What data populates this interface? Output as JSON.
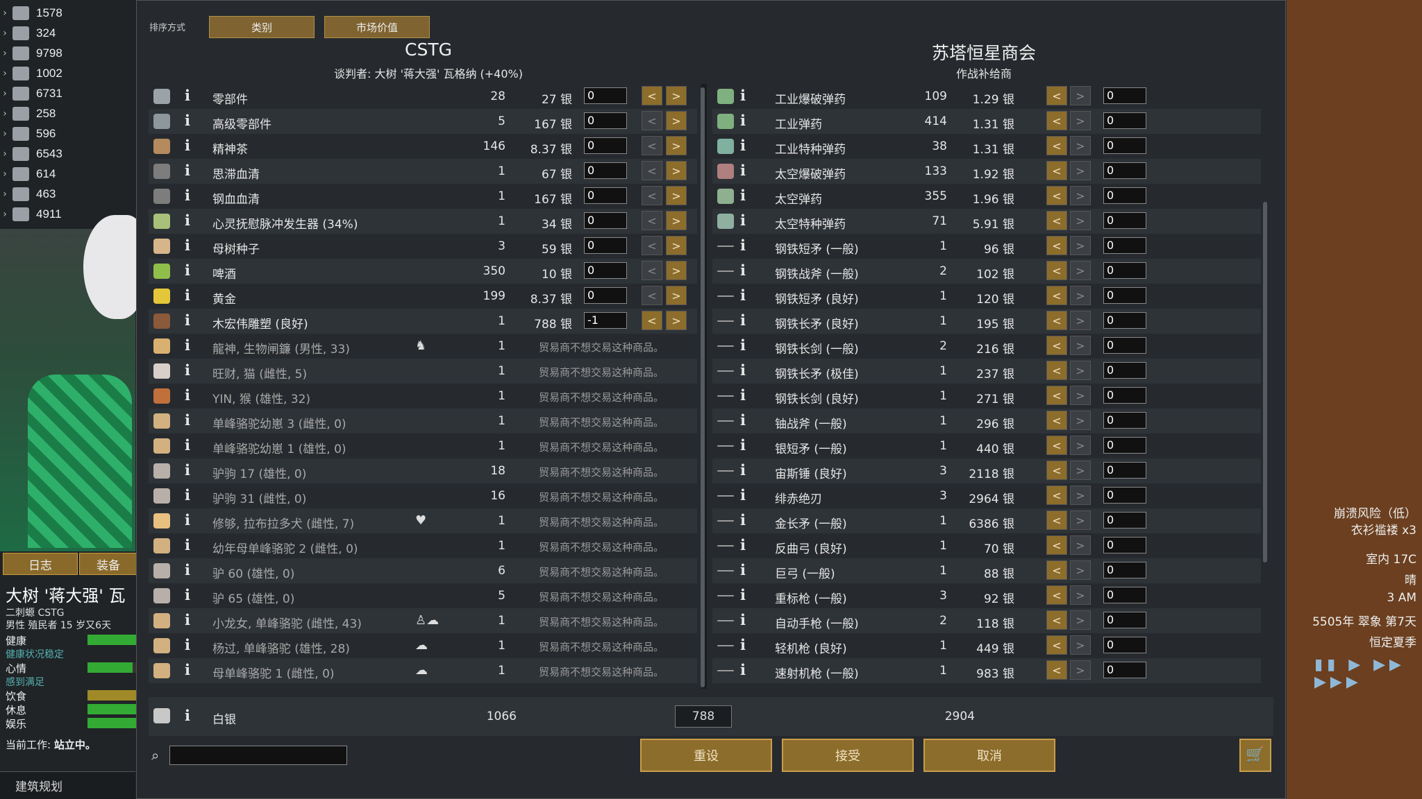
{
  "left_hud": {
    "resources": [
      {
        "icon": "meal-icon",
        "value": "1578"
      },
      {
        "icon": "medicine-icon",
        "value": "324"
      },
      {
        "icon": "textile-icon",
        "value": "9798"
      },
      {
        "icon": "tool-icon",
        "value": "1002"
      },
      {
        "icon": "building-material-icon",
        "value": "6731"
      },
      {
        "icon": "medical-icon",
        "value": "258"
      },
      {
        "icon": "raw-food-icon",
        "value": "596"
      },
      {
        "icon": "stone-icon",
        "value": "6543"
      },
      {
        "icon": "plant-icon",
        "value": "614"
      },
      {
        "icon": "furniture-icon",
        "value": "463"
      },
      {
        "icon": "resource-icon",
        "value": "4911"
      }
    ],
    "tabs": {
      "log": "日志",
      "equip": "装备"
    },
    "colonist": {
      "name": "大树 '蒋大强' 瓦",
      "faction": "二刺螈 CSTG",
      "desc": "男性 殖民者 15 岁又6天",
      "needs": [
        {
          "label": "健康",
          "fill": 1.0,
          "color": "#33aa33"
        },
        {
          "label": "健康状况稳定",
          "fill": null,
          "color": "#55b0b0"
        },
        {
          "label": "心情",
          "fill": 0.9,
          "color": "#33aa33"
        },
        {
          "label": "感到满足",
          "fill": null,
          "color": "#55b0b0"
        },
        {
          "label": "饮食",
          "fill": 1.0,
          "color": "#a08a28"
        },
        {
          "label": "休息",
          "fill": 1.0,
          "color": "#33aa33"
        },
        {
          "label": "娱乐",
          "fill": 1.0,
          "color": "#33aa33"
        }
      ],
      "job_label": "当前工作:",
      "job_value": "站立中。"
    },
    "architect": "建筑规划"
  },
  "right_hud": {
    "alert1": "崩溃风险（低）",
    "alert2": "衣衫褴褛 x3",
    "temp": "室内 17C",
    "weather": "晴",
    "time": "3 AM",
    "date": "5505年 翠象 第7天",
    "season": "恒定夏季"
  },
  "dialog": {
    "sort_label": "排序方式",
    "sort_btn1": "类别",
    "sort_btn2": "市场价值",
    "left_title": "CSTG",
    "left_sub": "谈判者: 大树 '蒋大强' 瓦格纳 (+40%)",
    "right_title": "苏塔恒星商会",
    "right_sub": "作战补给商",
    "silver": {
      "name": "白银",
      "left": "1066",
      "trade": "788",
      "right": "2904"
    },
    "buttons": {
      "reset": "重设",
      "accept": "接受",
      "cancel": "取消"
    },
    "left_items": [
      {
        "name": "零部件",
        "count": "28",
        "price": "27 银",
        "qty": "0",
        "left_on": true
      },
      {
        "name": "高级零部件",
        "count": "5",
        "price": "167 银",
        "qty": "0",
        "left_on": false
      },
      {
        "name": "精神茶",
        "count": "146",
        "price": "8.37 银",
        "qty": "0",
        "left_on": false
      },
      {
        "name": "思滞血清",
        "count": "1",
        "price": "67 银",
        "qty": "0",
        "left_on": false
      },
      {
        "name": "钢血血清",
        "count": "1",
        "price": "167 银",
        "qty": "0",
        "left_on": false
      },
      {
        "name": "心灵抚慰脉冲发生器 (34%)",
        "count": "1",
        "price": "34 银",
        "qty": "0",
        "left_on": false
      },
      {
        "name": "母树种子",
        "count": "3",
        "price": "59 银",
        "qty": "0",
        "left_on": false
      },
      {
        "name": "啤酒",
        "count": "350",
        "price": "10 银",
        "qty": "0",
        "left_on": false
      },
      {
        "name": "黄金",
        "count": "199",
        "price": "8.37 银",
        "qty": "0",
        "left_on": false
      },
      {
        "name": "木宏伟雕塑 (良好)",
        "count": "1",
        "price": "788 银",
        "qty": "-1",
        "left_on": true
      },
      {
        "name": "龍神, 生物闸鐮 (男性, 33)",
        "count": "1",
        "mark": "♞",
        "note": "贸易商不想交易这种商品。"
      },
      {
        "name": "旺财, 猫 (雌性, 5)",
        "count": "1",
        "note": "贸易商不想交易这种商品。"
      },
      {
        "name": "YIN, 猴 (雄性, 32)",
        "count": "1",
        "note": "贸易商不想交易这种商品。"
      },
      {
        "name": "单峰骆驼幼崽 3 (雌性, 0)",
        "count": "1",
        "note": "贸易商不想交易这种商品。"
      },
      {
        "name": "单峰骆驼幼崽 1 (雄性, 0)",
        "count": "1",
        "note": "贸易商不想交易这种商品。"
      },
      {
        "name": "驴驹 17 (雄性, 0)",
        "count": "18",
        "note": "贸易商不想交易这种商品。"
      },
      {
        "name": "驴驹 31 (雌性, 0)",
        "count": "16",
        "note": "贸易商不想交易这种商品。"
      },
      {
        "name": "修够, 拉布拉多犬 (雌性, 7)",
        "count": "1",
        "mark": "♥",
        "note": "贸易商不想交易这种商品。"
      },
      {
        "name": "幼年母单峰骆驼 2 (雌性, 0)",
        "count": "1",
        "note": "贸易商不想交易这种商品。"
      },
      {
        "name": "驴 60 (雄性, 0)",
        "count": "6",
        "note": "贸易商不想交易这种商品。"
      },
      {
        "name": "驴 65 (雄性, 0)",
        "count": "5",
        "note": "贸易商不想交易这种商品。"
      },
      {
        "name": "小龙女, 单峰骆驼 (雌性, 43)",
        "count": "1",
        "mark": "♙☁",
        "note": "贸易商不想交易这种商品。"
      },
      {
        "name": "杨过, 单峰骆驼 (雄性, 28)",
        "count": "1",
        "mark": "☁",
        "note": "贸易商不想交易这种商品。"
      },
      {
        "name": "母单峰骆驼 1 (雌性, 0)",
        "count": "1",
        "mark": "☁",
        "note": "贸易商不想交易这种商品。"
      }
    ],
    "right_items": [
      {
        "name": "工业爆破弹药",
        "count": "109",
        "price": "1.29 银",
        "qty": "0"
      },
      {
        "name": "工业弹药",
        "count": "414",
        "price": "1.31 银",
        "qty": "0"
      },
      {
        "name": "工业特种弹药",
        "count": "38",
        "price": "1.31 银",
        "qty": "0"
      },
      {
        "name": "太空爆破弹药",
        "count": "133",
        "price": "1.92 银",
        "qty": "0"
      },
      {
        "name": "太空弹药",
        "count": "355",
        "price": "1.96 银",
        "qty": "0"
      },
      {
        "name": "太空特种弹药",
        "count": "71",
        "price": "5.91 银",
        "qty": "0"
      },
      {
        "name": "钢铁短矛 (一般)",
        "count": "1",
        "price": "96 银",
        "qty": "0"
      },
      {
        "name": "钢铁战斧 (一般)",
        "count": "2",
        "price": "102 银",
        "qty": "0"
      },
      {
        "name": "钢铁短矛 (良好)",
        "count": "1",
        "price": "120 银",
        "qty": "0"
      },
      {
        "name": "钢铁长矛 (良好)",
        "count": "1",
        "price": "195 银",
        "qty": "0"
      },
      {
        "name": "钢铁长剑 (一般)",
        "count": "2",
        "price": "216 银",
        "qty": "0"
      },
      {
        "name": "钢铁长矛 (极佳)",
        "count": "1",
        "price": "237 银",
        "qty": "0"
      },
      {
        "name": "钢铁长剑 (良好)",
        "count": "1",
        "price": "271 银",
        "qty": "0"
      },
      {
        "name": "铀战斧 (一般)",
        "count": "1",
        "price": "296 银",
        "qty": "0"
      },
      {
        "name": "银短矛 (一般)",
        "count": "1",
        "price": "440 银",
        "qty": "0"
      },
      {
        "name": "宙斯锤 (良好)",
        "count": "3",
        "price": "2118 银",
        "qty": "0"
      },
      {
        "name": "绯赤绝刃",
        "count": "3",
        "price": "2964 银",
        "qty": "0"
      },
      {
        "name": "金长矛 (一般)",
        "count": "1",
        "price": "6386 银",
        "qty": "0"
      },
      {
        "name": "反曲弓 (良好)",
        "count": "1",
        "price": "70 银",
        "qty": "0"
      },
      {
        "name": "巨弓 (一般)",
        "count": "1",
        "price": "88 银",
        "qty": "0"
      },
      {
        "name": "重标枪 (一般)",
        "count": "3",
        "price": "92 银",
        "qty": "0"
      },
      {
        "name": "自动手枪 (一般)",
        "count": "2",
        "price": "118 银",
        "qty": "0"
      },
      {
        "name": "轻机枪 (良好)",
        "count": "1",
        "price": "449 银",
        "qty": "0"
      },
      {
        "name": "速射机枪 (一般)",
        "count": "1",
        "price": "983 银",
        "qty": "0"
      }
    ],
    "arrow_left": "<",
    "arrow_right": ">"
  },
  "colors": {
    "accent": "#8d6d2b",
    "panel": "#262a2e"
  }
}
